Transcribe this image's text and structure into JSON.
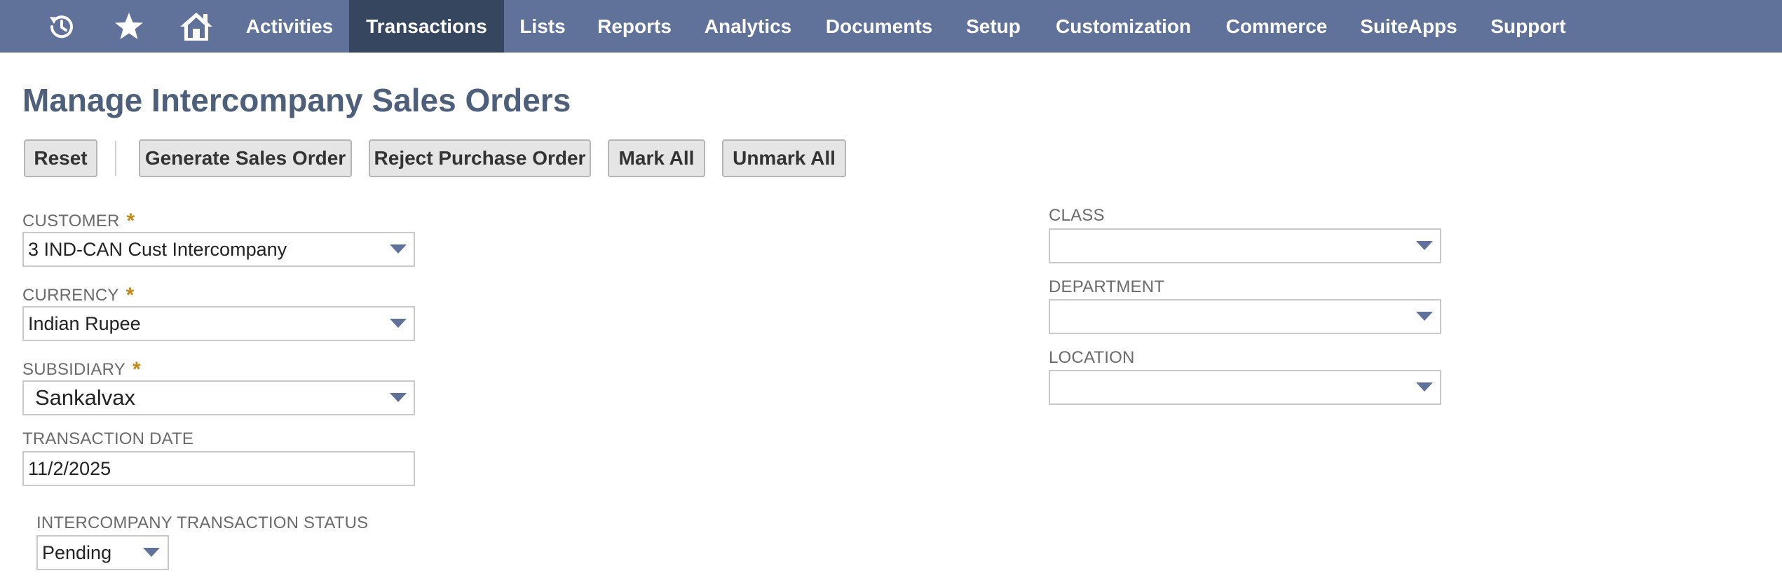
{
  "nav": {
    "icons": [
      {
        "name": "recent-history-icon"
      },
      {
        "name": "star-icon"
      },
      {
        "name": "home-icon"
      }
    ],
    "items": [
      {
        "label": "Activities"
      },
      {
        "label": "Transactions",
        "active": true
      },
      {
        "label": "Lists"
      },
      {
        "label": "Reports"
      },
      {
        "label": "Analytics"
      },
      {
        "label": "Documents"
      },
      {
        "label": "Setup"
      },
      {
        "label": "Customization"
      },
      {
        "label": "Commerce"
      },
      {
        "label": "SuiteApps"
      },
      {
        "label": "Support"
      }
    ]
  },
  "page": {
    "title": "Manage Intercompany Sales Orders"
  },
  "toolbar": {
    "reset": "Reset",
    "generate_sales_order": "Generate Sales Order",
    "reject_purchase_order": "Reject Purchase Order",
    "mark_all": "Mark All",
    "unmark_all": "Unmark All"
  },
  "form": {
    "required_marker": "*",
    "customer": {
      "label": "CUSTOMER",
      "value": "3 IND-CAN Cust Intercompany"
    },
    "currency": {
      "label": "CURRENCY",
      "value": "Indian Rupee"
    },
    "subsidiary": {
      "label": "SUBSIDIARY",
      "value": "Sankalvax"
    },
    "transaction_date": {
      "label": "TRANSACTION DATE",
      "value": "11/2/2025"
    },
    "status": {
      "label": "INTERCOMPANY TRANSACTION STATUS",
      "value": "Pending"
    },
    "class": {
      "label": "CLASS",
      "value": ""
    },
    "department": {
      "label": "DEPARTMENT",
      "value": ""
    },
    "location": {
      "label": "LOCATION",
      "value": ""
    }
  },
  "colors": {
    "nav_bg": "#607299",
    "nav_active_bg": "#36465e",
    "title": "#4d5f7a",
    "required": "#c48a18",
    "caret": "#607299"
  }
}
